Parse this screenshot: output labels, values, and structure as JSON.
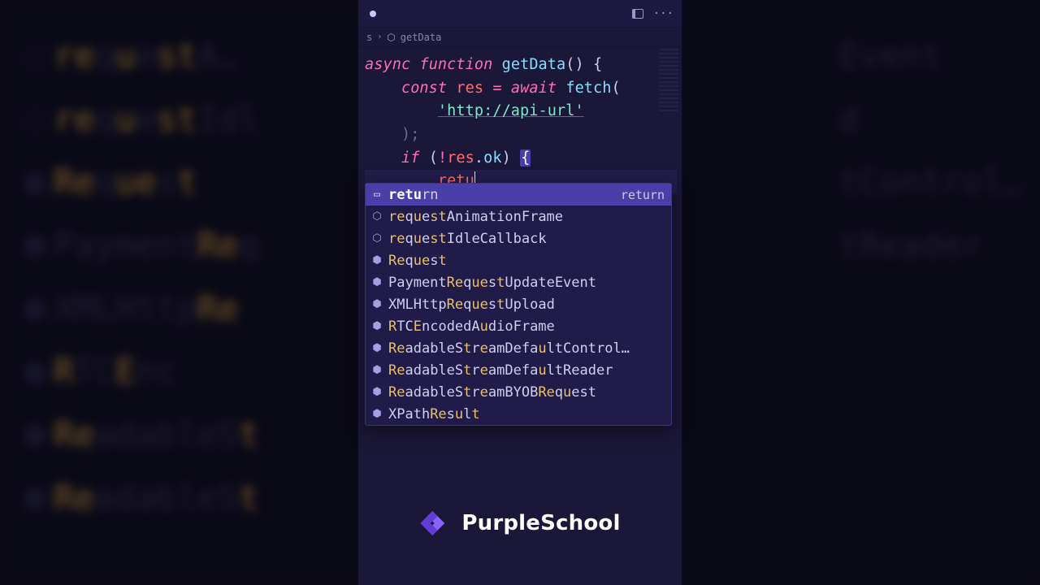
{
  "breadcrumb": {
    "suffix": "s",
    "symbol": "getData"
  },
  "code": {
    "kw_async": "async",
    "kw_function": "function",
    "fn_name": "getData",
    "parens": "()",
    "brace_open": "{",
    "kw_const": "const",
    "var_res": "res",
    "eq": "=",
    "kw_await": "await",
    "fn_fetch": "fetch",
    "open_paren": "(",
    "str_url": "'http://api-url'",
    "close_paren_semi": ");",
    "kw_if": "if",
    "bang": "!",
    "prop_ok": "ok",
    "dot": ".",
    "if_brace": "{",
    "typed": "retu"
  },
  "autocomplete": {
    "hint": "return",
    "items": [
      {
        "icon": "kw",
        "segs": [
          "retu",
          "rn"
        ],
        "selected": true
      },
      {
        "icon": "fn",
        "segs": [
          "r",
          "e",
          "q",
          "u",
          "e",
          "st",
          "AnimationFrame"
        ],
        "hl": [
          0,
          1,
          3,
          5
        ]
      },
      {
        "icon": "fn",
        "segs": [
          "r",
          "e",
          "q",
          "u",
          "e",
          "st",
          "IdleCallback"
        ],
        "hl": [
          0,
          1,
          3,
          5
        ]
      },
      {
        "icon": "cl",
        "segs": [
          "Re",
          "q",
          "u",
          "e",
          "s",
          "t"
        ],
        "hl": [
          0,
          2,
          3,
          5
        ]
      },
      {
        "icon": "cl",
        "segs": [
          "Payment",
          "Re",
          "q",
          "u",
          "e",
          "s",
          "t",
          "U",
          "pdateEvent"
        ],
        "hl": [
          1,
          3,
          4,
          6
        ]
      },
      {
        "icon": "cl",
        "segs": [
          "XMLHttp",
          "Re",
          "q",
          "u",
          "e",
          "s",
          "t",
          "U",
          "pload"
        ],
        "hl": [
          1,
          3,
          4,
          6
        ]
      },
      {
        "icon": "cl",
        "segs": [
          "R",
          "TC",
          "E",
          "ncodedA",
          "u",
          "dioFrame"
        ],
        "hl": [
          0,
          2,
          4
        ]
      },
      {
        "icon": "cl",
        "segs": [
          "Re",
          "adableS",
          "t",
          "r",
          "e",
          "amDefa",
          "u",
          "ltControl…"
        ],
        "hl": [
          0,
          2,
          4,
          6
        ]
      },
      {
        "icon": "cl",
        "segs": [
          "Re",
          "adableS",
          "t",
          "r",
          "e",
          "amDefa",
          "u",
          "ltReader"
        ],
        "hl": [
          0,
          2,
          4,
          6
        ]
      },
      {
        "icon": "cl",
        "segs": [
          "Re",
          "adableS",
          "t",
          "r",
          "e",
          "amBYOB",
          "Re",
          "q",
          "u",
          "est"
        ],
        "hl": [
          0,
          2,
          4,
          6,
          8
        ]
      },
      {
        "icon": "cl",
        "segs": [
          "XPath",
          "Re",
          "s",
          "u",
          "l",
          "t"
        ],
        "hl": [
          1,
          3,
          5
        ]
      }
    ]
  },
  "brand": {
    "name": "PurpleSchool"
  },
  "bg_lines": [
    {
      "icon": "⬡",
      "segs": [
        "r",
        "e",
        "q",
        "u",
        "e",
        "st",
        "A…"
      ],
      "hl": [
        0,
        1,
        3,
        5
      ]
    },
    {
      "icon": "⬡",
      "segs": [
        "r",
        "e",
        "q",
        "u",
        "e",
        "st",
        "Idl"
      ],
      "hl": [
        0,
        1,
        3,
        5
      ]
    },
    {
      "icon": "⬢",
      "segs": [
        "Re",
        "q",
        "u",
        "e",
        "s",
        "t"
      ],
      "hl": [
        0,
        2,
        3,
        5
      ]
    },
    {
      "icon": "⬢",
      "segs": [
        "Payment",
        "Re",
        "q"
      ],
      "hl": [
        1
      ]
    },
    {
      "icon": "⬢",
      "segs": [
        "XMLHttp",
        "Re"
      ],
      "hl": [
        1
      ]
    },
    {
      "icon": "⬢",
      "segs": [
        "R",
        "TC",
        "E",
        "nc"
      ],
      "hl": [
        0,
        2
      ]
    },
    {
      "icon": "⬢",
      "segs": [
        "Re",
        "adableS",
        "t"
      ],
      "hl": [
        0,
        2
      ]
    },
    {
      "icon": "⬢",
      "segs": [
        "Re",
        "adableS",
        "t"
      ],
      "hl": [
        0,
        2
      ]
    }
  ],
  "bg_right": [
    "",
    "",
    "",
    "Event",
    "d",
    "",
    "tControl…",
    "tReader"
  ]
}
